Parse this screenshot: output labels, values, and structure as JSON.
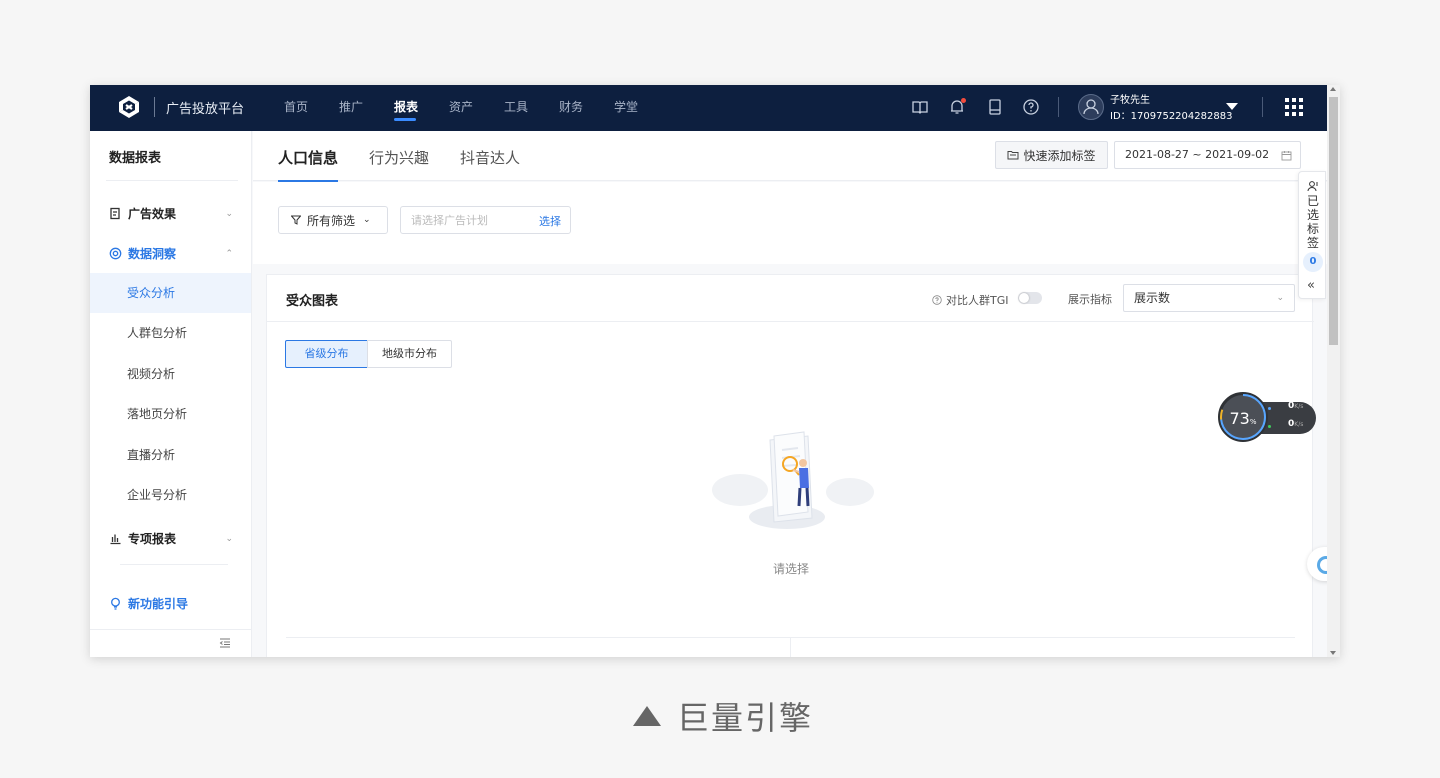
{
  "app": {
    "platform_name": "广告投放平台",
    "nav": [
      "首页",
      "推广",
      "报表",
      "资产",
      "工具",
      "财务",
      "学堂"
    ],
    "nav_active_index": 2,
    "user": {
      "name": "子牧先生",
      "id_label": "ID：1709752204282883"
    }
  },
  "sidebar": {
    "title": "数据报表",
    "groups": {
      "ad_effect": "广告效果",
      "insight": "数据洞察",
      "special": "专项报表",
      "guide": "新功能引导"
    },
    "items": [
      "受众分析",
      "人群包分析",
      "视频分析",
      "落地页分析",
      "直播分析",
      "企业号分析"
    ],
    "active_item_index": 0
  },
  "tabs": [
    "人口信息",
    "行为兴趣",
    "抖音达人"
  ],
  "tab_active_index": 0,
  "toolbar": {
    "quick_add_label": "快速添加标签",
    "date_range": "2021-08-27 ~ 2021-09-02"
  },
  "filter": {
    "all_filter_label": "所有筛选",
    "plan_placeholder": "请选择广告计划",
    "plan_select_label": "选择"
  },
  "card": {
    "title": "受众图表",
    "tgi_label": "对比人群TGI",
    "tgi_enabled": false,
    "metric_label": "展示指标",
    "metric_value": "展示数",
    "segments": [
      "省级分布",
      "地级市分布"
    ],
    "segment_active_index": 0,
    "empty_text": "请选择"
  },
  "tag_panel": {
    "label": "已选标签",
    "count": "0"
  },
  "speed_widget": {
    "percent": "73",
    "percent_unit": "%",
    "upload": "0",
    "download": "0",
    "unit": "K/s"
  },
  "caption": "巨量引擎",
  "colors": {
    "topbar": "#0d1f3f",
    "accent": "#2b78e4",
    "active_bg": "#eef4fd"
  }
}
